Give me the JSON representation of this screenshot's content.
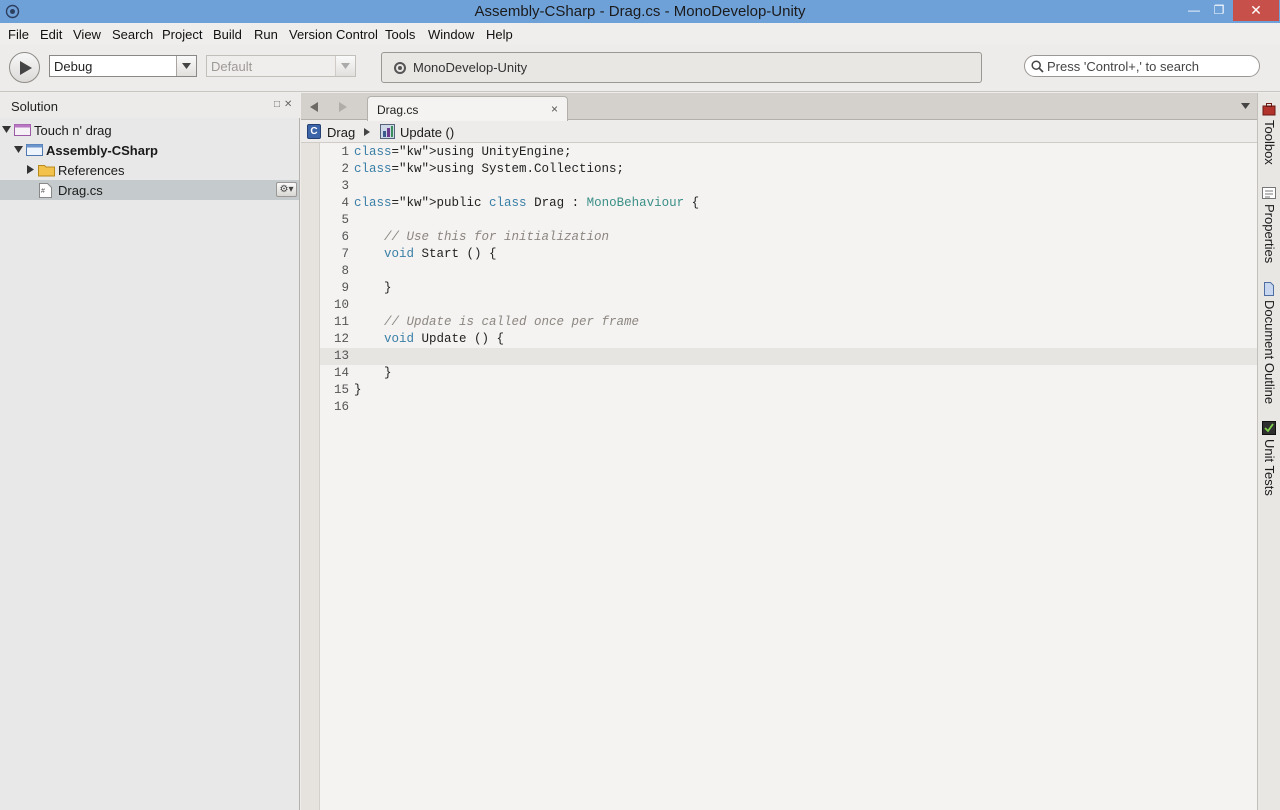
{
  "window": {
    "title": "Assembly-CSharp - Drag.cs - MonoDevelop-Unity",
    "min_glyph": "—",
    "max_glyph": "❐",
    "close_glyph": "✕"
  },
  "menu": [
    "File",
    "Edit",
    "View",
    "Search",
    "Project",
    "Build",
    "Run",
    "Version Control",
    "Tools",
    "Window",
    "Help"
  ],
  "toolbar": {
    "config": "Debug",
    "platform": "Default",
    "status": "MonoDevelop-Unity",
    "search_placeholder": "Press 'Control+,' to search"
  },
  "solution_pad": {
    "title": "Solution",
    "items": [
      {
        "label": "Touch n' drag",
        "icon": "solution-icon",
        "expanded": true
      },
      {
        "label": "Assembly-CSharp",
        "icon": "project-icon",
        "expanded": true
      },
      {
        "label": "References",
        "icon": "folder-icon",
        "expanded": false
      },
      {
        "label": "Drag.cs",
        "icon": "cs-file-icon",
        "selected": true
      }
    ],
    "gear_glyph": "⚙▾"
  },
  "editor": {
    "tab_label": "Drag.cs",
    "tab_close": "×",
    "breadcrumb": {
      "class_icon_letter": "C",
      "class_name": "Drag",
      "method_name": "Update ()"
    },
    "current_line": 13,
    "lines": [
      {
        "n": "1",
        "code": "using UnityEngine;"
      },
      {
        "n": "2",
        "code": "using System.Collections;"
      },
      {
        "n": "3",
        "code": ""
      },
      {
        "n": "4",
        "code": "public class Drag : MonoBehaviour {"
      },
      {
        "n": "5",
        "code": ""
      },
      {
        "n": "6",
        "code": "    // Use this for initialization"
      },
      {
        "n": "7",
        "code": "    void Start () {"
      },
      {
        "n": "8",
        "code": ""
      },
      {
        "n": "9",
        "code": "    }"
      },
      {
        "n": "10",
        "code": ""
      },
      {
        "n": "11",
        "code": "    // Update is called once per frame"
      },
      {
        "n": "12",
        "code": "    void Update () {"
      },
      {
        "n": "13",
        "code": ""
      },
      {
        "n": "14",
        "code": "    }"
      },
      {
        "n": "15",
        "code": "}"
      },
      {
        "n": "16",
        "code": ""
      }
    ]
  },
  "right_dock": [
    {
      "label": "Toolbox",
      "icon": "toolbox-icon"
    },
    {
      "label": "Properties",
      "icon": "properties-icon"
    },
    {
      "label": "Document Outline",
      "icon": "document-outline-icon"
    },
    {
      "label": "Unit Tests",
      "icon": "unit-tests-icon"
    }
  ]
}
